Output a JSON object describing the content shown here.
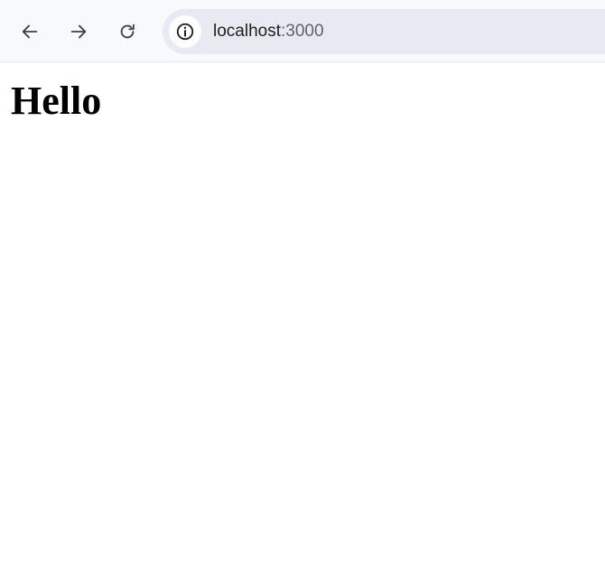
{
  "browser": {
    "address_bar": {
      "host": "localhost",
      "port": ":3000"
    },
    "icons": {
      "back": "arrow-left-icon",
      "forward": "arrow-right-icon",
      "reload": "reload-icon",
      "site_info": "info-icon"
    }
  },
  "page": {
    "heading": "Hello"
  },
  "colors": {
    "toolbar_bg": "#f8f9fd",
    "omnibox_bg": "#e8eaf2",
    "icon": "#3c4043",
    "page_bg": "#ffffff",
    "text": "#000000"
  }
}
